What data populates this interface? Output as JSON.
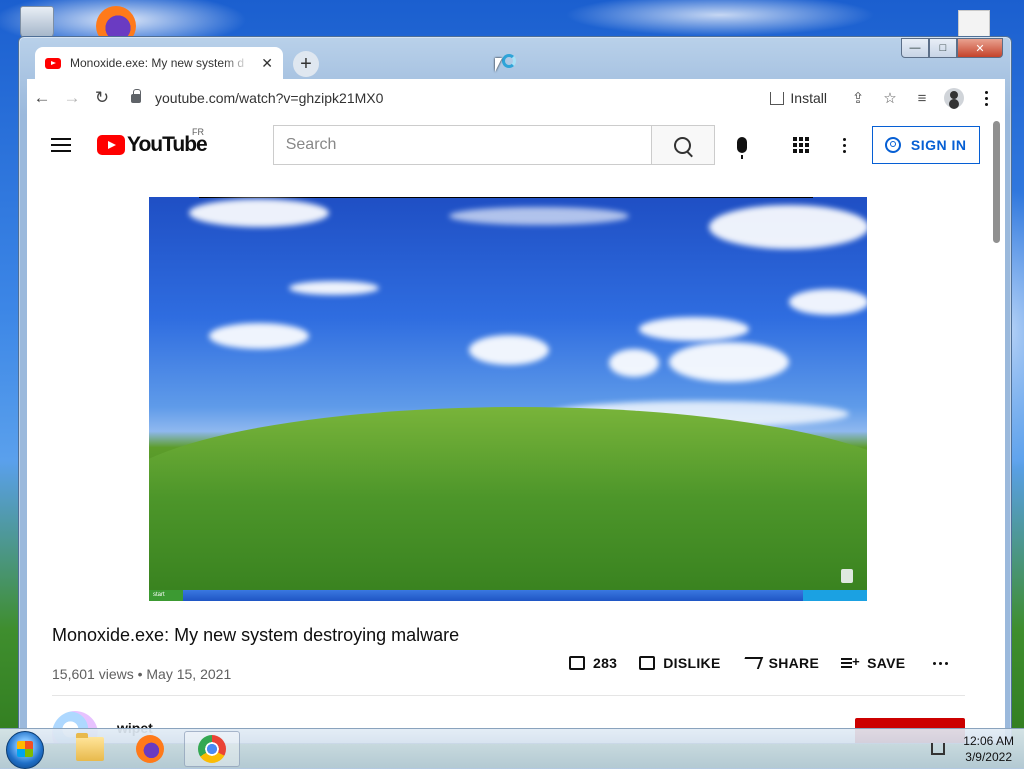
{
  "desktop": {
    "icons": [
      "recycle-bin-icon",
      "firefox-icon",
      "document-icon"
    ]
  },
  "browser": {
    "tab": {
      "title": "Monoxide.exe: My new system d",
      "close": "✕"
    },
    "new_tab": "+",
    "window_controls": {
      "minimize": "—",
      "maximize": "□",
      "close": "✕"
    },
    "toolbar": {
      "back": "←",
      "forward": "→",
      "reload": "↻",
      "url": "youtube.com/watch?v=ghzipk21MX0",
      "install_label": "Install",
      "share": "⇪",
      "bookmark": "☆",
      "reading_list": "≡"
    }
  },
  "youtube": {
    "logo_text": "YouTube",
    "country_code": "FR",
    "search_placeholder": "Search",
    "sign_in_label": "SIGN IN",
    "video": {
      "title": "Monoxide.exe: My new system destroying malware",
      "meta": "15,601 views • May 15, 2021",
      "xp_start_label": "start",
      "like_count": "283",
      "dislike_label": "DISLIKE",
      "share_label": "SHARE",
      "save_label": "SAVE"
    },
    "channel": {
      "name": "wipet"
    },
    "colors": {
      "brand_red": "#ff0000",
      "link_blue": "#065fd4"
    }
  },
  "taskbar": {
    "apps": [
      "windows-explorer",
      "firefox",
      "google-chrome"
    ],
    "clock": {
      "time": "12:06 AM",
      "date": "3/9/2022"
    }
  }
}
